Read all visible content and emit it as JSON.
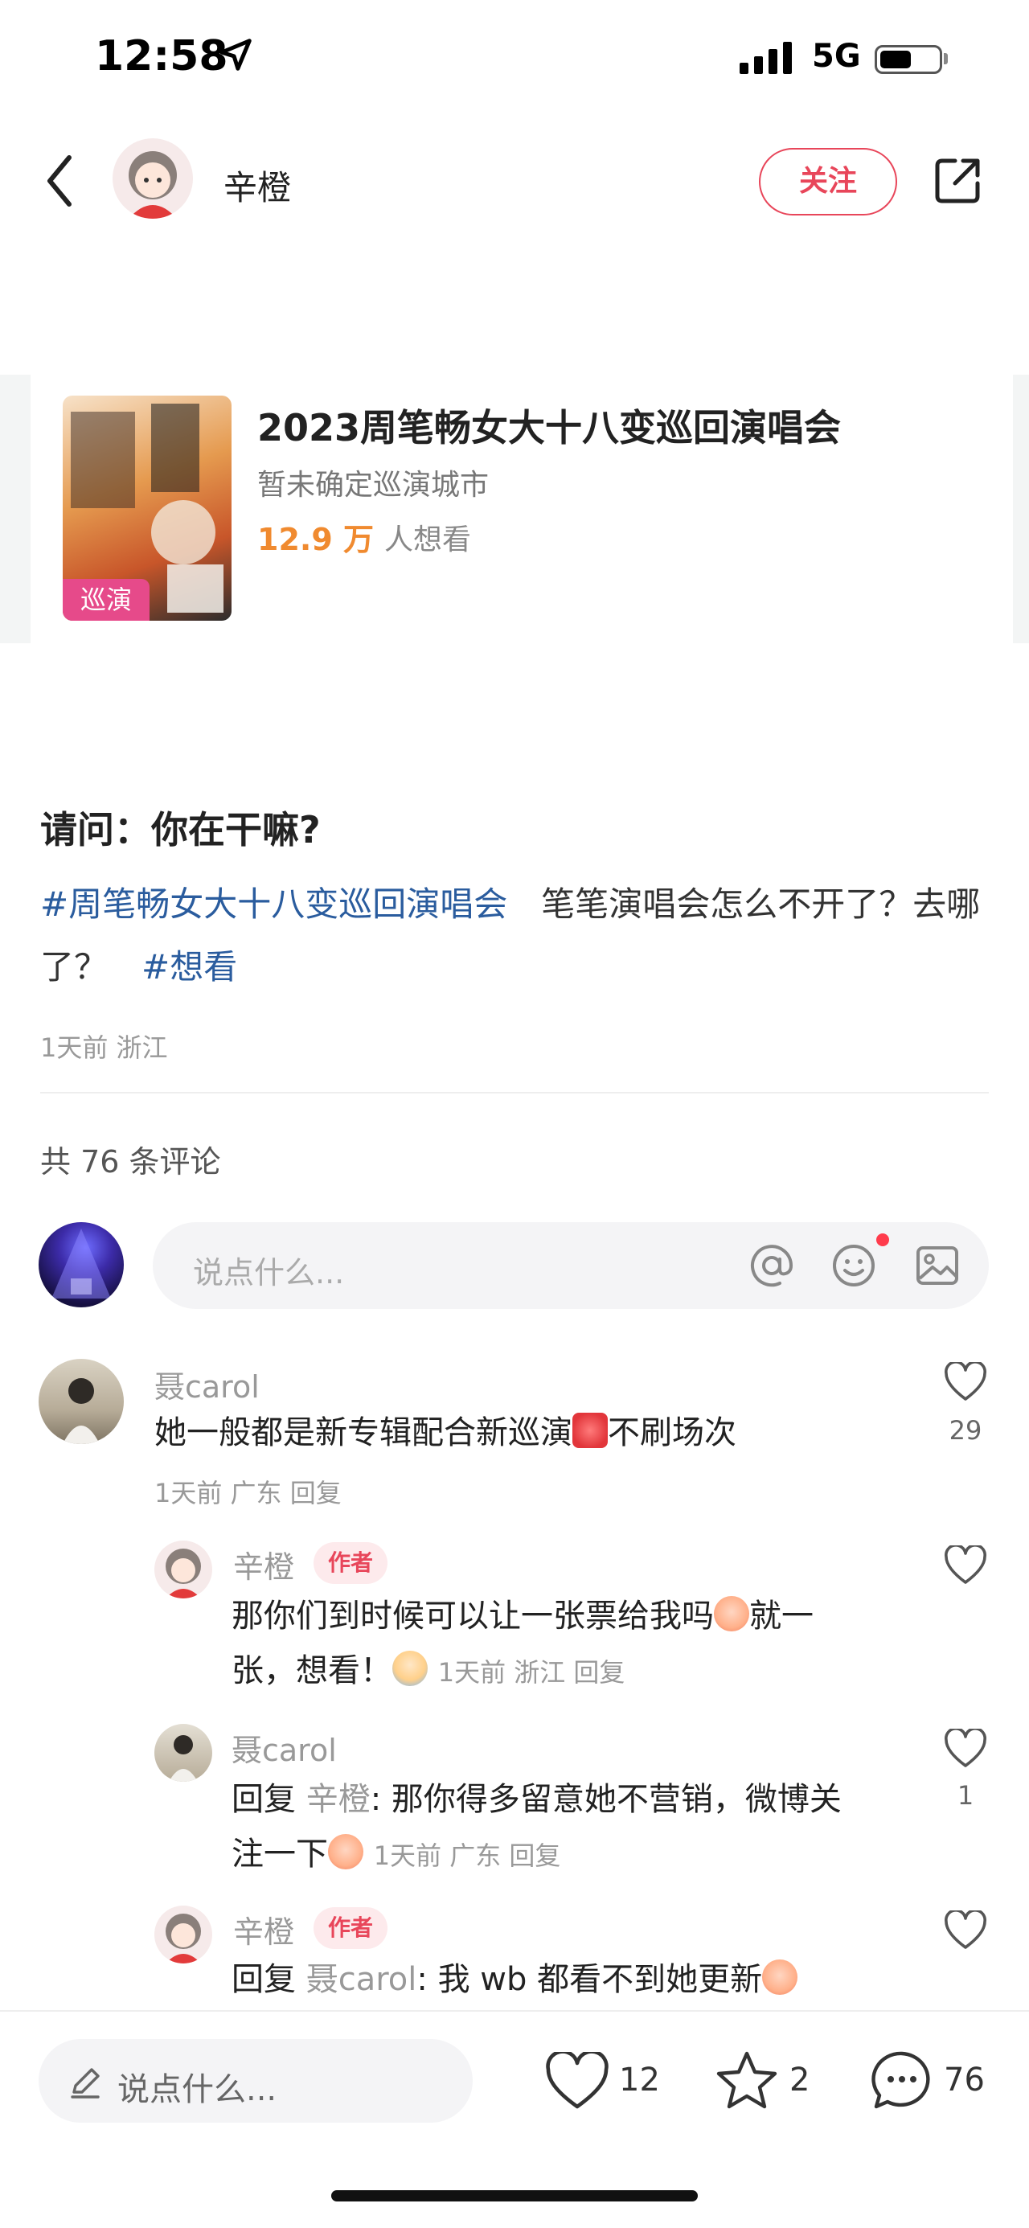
{
  "status_bar": {
    "time": "12:58",
    "network": "5G"
  },
  "header": {
    "author_name": "辛橙",
    "follow_label": "关注"
  },
  "event_card": {
    "title": "2023周笔畅女大十八变巡回演唱会",
    "subtitle": "暂未确定巡演城市",
    "want_count": "12.9 万",
    "want_label": "人想看",
    "poster_tag": "巡演"
  },
  "post": {
    "title": "请问：你在干嘛?",
    "hashtag1": "#周笔畅女大十八变巡回演唱会",
    "text1": "笔笔演唱会怎么不开了？去哪了？",
    "hashtag2": "#想看",
    "meta": "1天前 浙江"
  },
  "comments_header": "共 76 条评论",
  "comment_input": {
    "placeholder": "说点什么..."
  },
  "comments": [
    {
      "name": "聂carol",
      "text_before": "她一般都是新专辑配合新巡演",
      "text_after": "不刷场次",
      "meta": "1天前 广东 回复",
      "likes": "29"
    }
  ],
  "replies": [
    {
      "name": "辛橙",
      "tag": "作者",
      "line1_before": "那你们到时候可以让一张票给我吗",
      "line1_after": "就一",
      "line2": "张，想看！",
      "meta": "1天前 浙江 回复"
    },
    {
      "name": "聂carol",
      "reply_prefix": "回复",
      "reply_to": "辛橙",
      "line1": "那你得多留意她不营销，微博关",
      "line2": "注一下",
      "meta": "1天前 广东 回复",
      "likes": "1"
    },
    {
      "name": "辛橙",
      "tag": "作者",
      "reply_prefix": "回复",
      "reply_to": "聂carol",
      "line1": "我 wb 都看不到她更新"
    }
  ],
  "bottom_bar": {
    "placeholder": "说点什么...",
    "likes": "12",
    "stars": "2",
    "comments": "76"
  },
  "colors": {
    "accent": "#e8465a",
    "hashtag": "#2a5c9e",
    "count_orange": "#f08a2f"
  }
}
